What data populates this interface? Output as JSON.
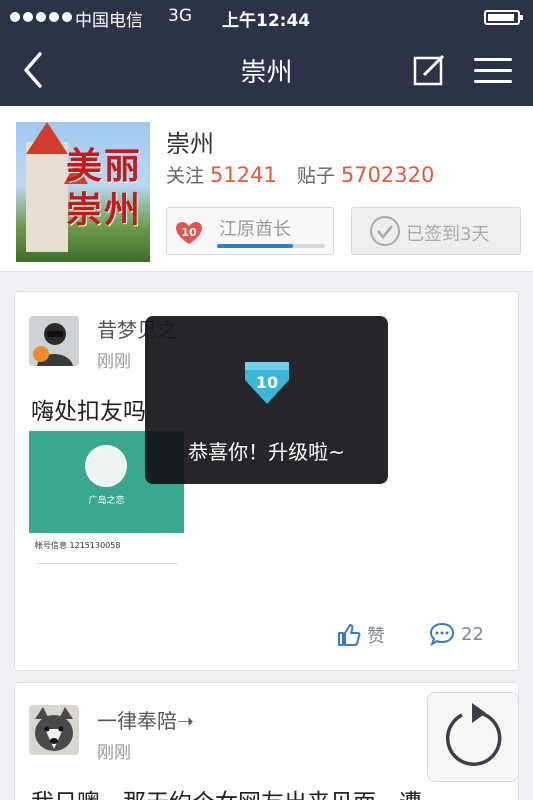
{
  "status_bar": {
    "carrier": "中国电信",
    "network": "3G",
    "time": "上午12:44"
  },
  "nav": {
    "title": "崇州",
    "back_icon": "chevron-left-icon",
    "edit_icon": "edit-icon",
    "menu_icon": "menu-icon"
  },
  "forum": {
    "name": "崇州",
    "follow_label": "关注",
    "follow_count": "51241",
    "posts_label": "贴子",
    "posts_count": "5702320",
    "logo_text": "美丽崇州",
    "level": "10",
    "level_title": "江原酋长",
    "level_progress": 0.7,
    "checkin_label": "已签到3天"
  },
  "posts": [
    {
      "author": "昔梦见之",
      "time": "刚刚",
      "text": "嗨处扣友吗",
      "image": {
        "name": "广岛之恋",
        "row_text": "帐号信息  1215130058"
      },
      "like_label": "赞",
      "comment_count": "22"
    },
    {
      "author": "一律奉陪➝",
      "time": "刚刚",
      "text": "我日噢，那天约个女网友出来见面，遭"
    }
  ],
  "toast": {
    "level": "10",
    "message": "恭喜你！升级啦~"
  },
  "colors": {
    "nav_bg": "#2b3349",
    "accent_red": "#e35a3b",
    "accent_blue": "#2f7fd0"
  }
}
